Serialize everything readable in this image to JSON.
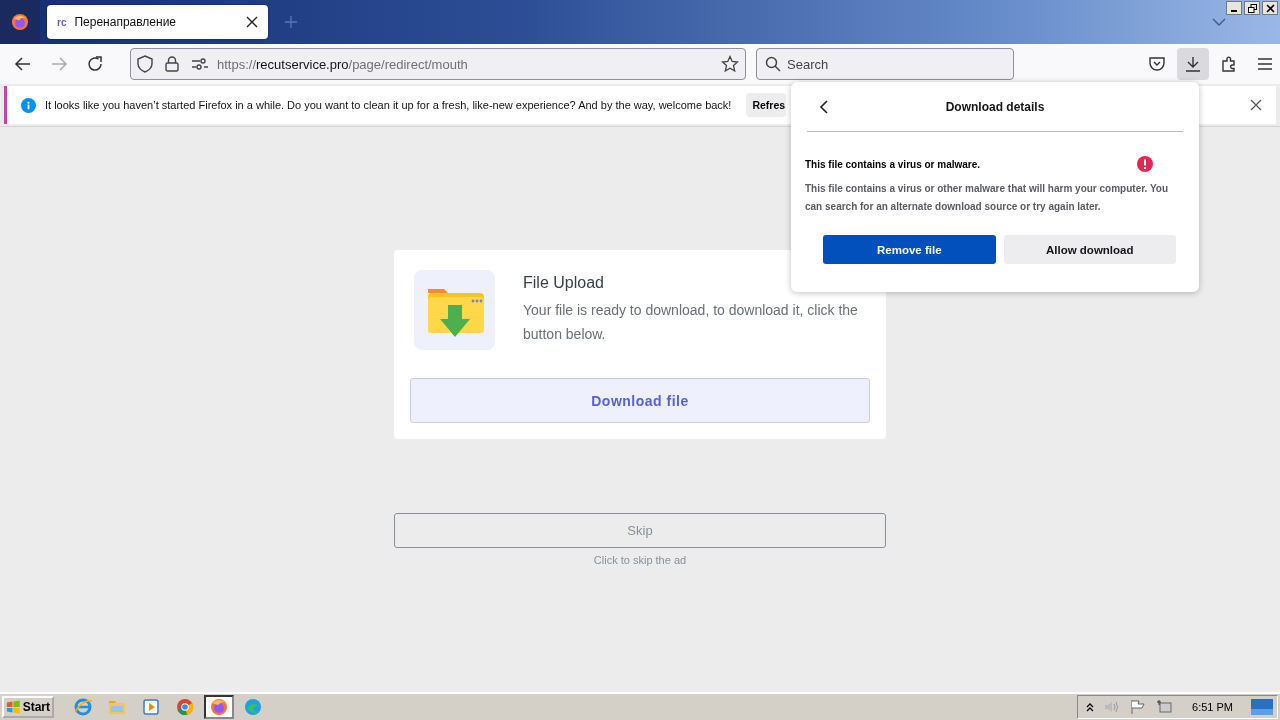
{
  "browser": {
    "tabs": [
      {
        "favicon": "rc",
        "title": "Перенаправление",
        "selected": true
      }
    ],
    "address_bar": {
      "scheme": "https://",
      "domain": "recutservice.pro",
      "path": "/page/redirect/mouth"
    },
    "search": {
      "placeholder": "Search"
    },
    "downloads_active": true
  },
  "notification": {
    "message": "It looks like you haven’t started Firefox in a while. Do you want to clean it up for a fresh, like-new experience? And by the way, welcome back!",
    "button": "Refres"
  },
  "download_panel": {
    "title": "Download details",
    "warning_title": "This file contains a virus or malware.",
    "warning_text": "This file contains a virus or other malware that will harm your computer. You can search for an alternate download source or try again later.",
    "buttons": [
      {
        "label": "Remove file",
        "kind": "primary"
      },
      {
        "label": "Allow download",
        "kind": "secondary"
      }
    ]
  },
  "page": {
    "card": {
      "title": "File Upload",
      "text": "Your file is ready to download, to download it, click the button below.",
      "button": "Download file"
    },
    "skip": {
      "button": "Skip",
      "caption": "Click to skip the ad"
    }
  },
  "taskbar": {
    "start": "Start",
    "apps": [
      {
        "kind": "ie",
        "selected": false
      },
      {
        "kind": "explorer",
        "selected": false
      },
      {
        "kind": "media",
        "selected": false
      },
      {
        "kind": "chrome",
        "selected": false
      },
      {
        "kind": "firefox",
        "selected": true
      },
      {
        "kind": "edge",
        "selected": false
      }
    ],
    "clock": "6:51 PM"
  }
}
